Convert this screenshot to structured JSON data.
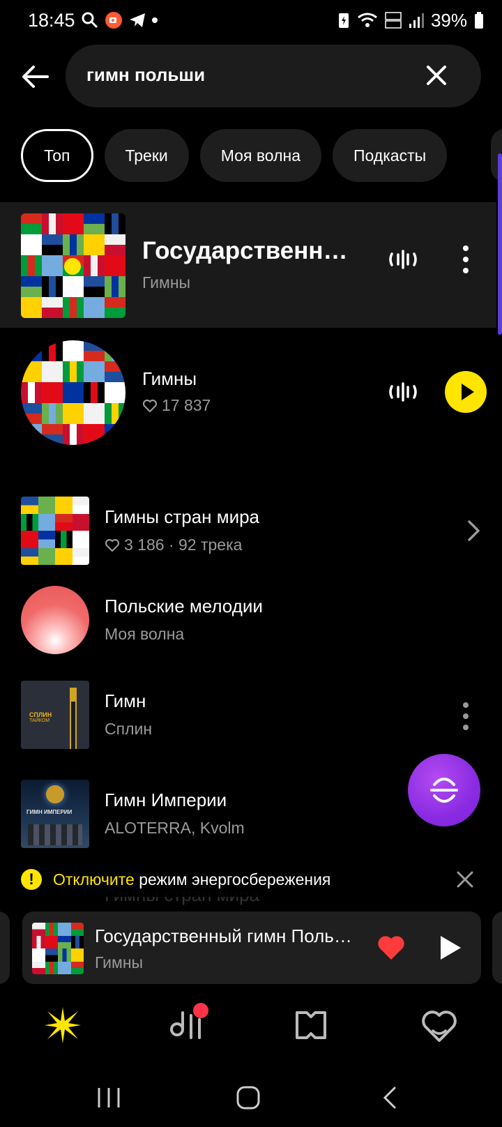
{
  "status_bar": {
    "time": "18:45",
    "battery": "39%",
    "icons_left": [
      "search-icon",
      "screen-record-icon",
      "telegram-icon",
      "dot-icon"
    ],
    "icons_right": [
      "battery-saver-icon",
      "wifi-icon",
      "volte-lte-icon",
      "signal-icon",
      "battery-icon"
    ]
  },
  "search": {
    "query": "гимн польши"
  },
  "chips": [
    {
      "label": "Топ",
      "active": true
    },
    {
      "label": "Треки",
      "active": false
    },
    {
      "label": "Моя волна",
      "active": false
    },
    {
      "label": "Подкасты",
      "active": false
    }
  ],
  "top_result": {
    "title": "Государственный гимн Польши",
    "subtitle": "Гимны"
  },
  "artist": {
    "name": "Гимны",
    "likes": "17 837"
  },
  "list": [
    {
      "title": "Гимны стран мира",
      "subtitle": "3 186 · 92 трека",
      "liked_icon": true
    },
    {
      "title": "Польские мелодии",
      "subtitle": "Моя волна"
    },
    {
      "title": "Гимн",
      "subtitle": "Сплин",
      "cover_text_1": "СПЛИН",
      "cover_text_2": "ТАЙКОМ"
    },
    {
      "title": "Гимн Империи",
      "subtitle": "ALOTERRA, Kvolm",
      "cover_text": "ГИМН ИМПЕРИИ"
    }
  ],
  "banner": {
    "link": "Отключите",
    "text": " режим энергосбережения",
    "ghost": "Гимны стран мира"
  },
  "player": {
    "title": "Государственный гимн Польши",
    "subtitle": "Гимны"
  },
  "colors": {
    "accent_yellow": "#ffe500",
    "heart_red": "#ff3b3b",
    "fab_purple": "#8a2be2",
    "badge_red": "#ff3347"
  },
  "bottom_nav": [
    "wave-star-icon",
    "music-collection-icon",
    "book-map-icon",
    "heart-face-icon"
  ]
}
